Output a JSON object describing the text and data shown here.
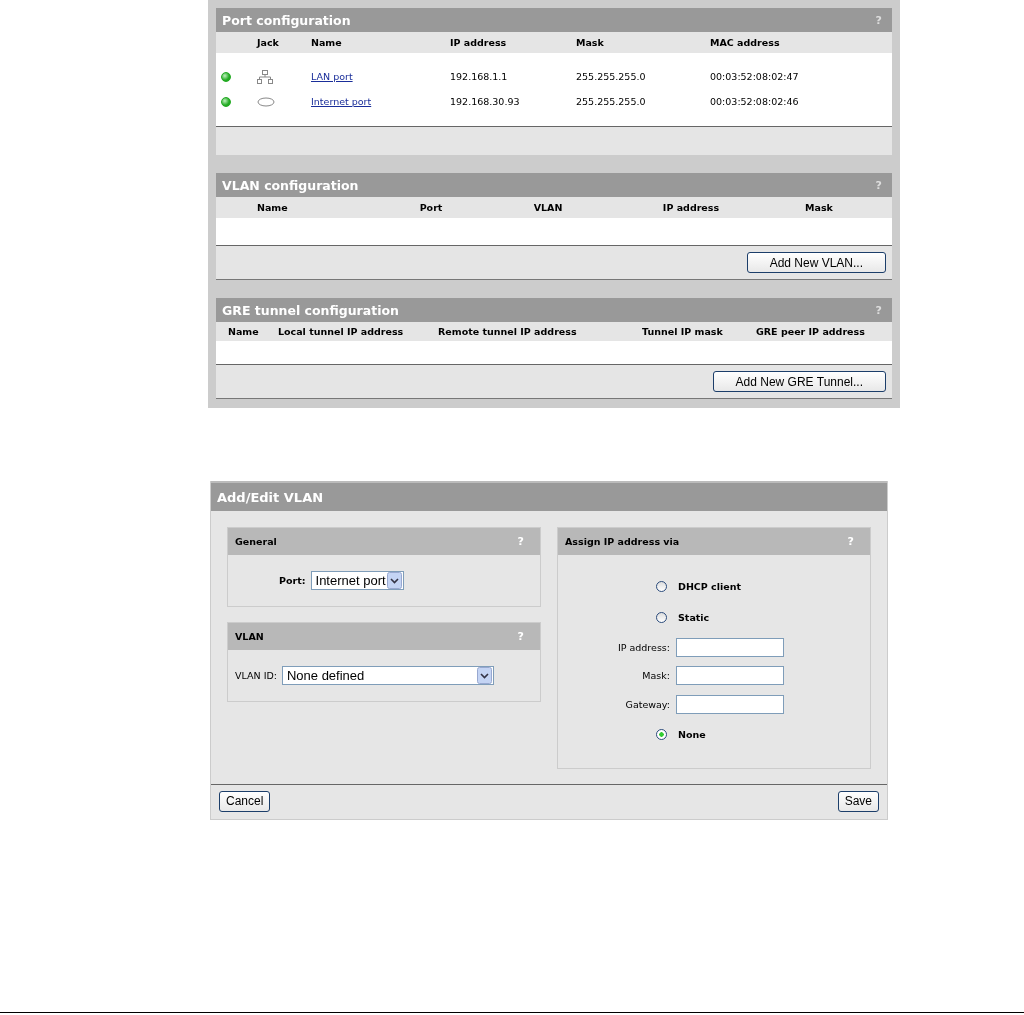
{
  "port_configuration": {
    "title": "Port configuration",
    "help": "?",
    "columns": [
      "Jack",
      "Name",
      "IP address",
      "Mask",
      "MAC address"
    ],
    "rows": [
      {
        "color": "#22aa22",
        "kind": "lan",
        "name": "LAN port",
        "ip": "192.168.1.1",
        "mask": "255.255.255.0",
        "mac": "00:03:52:08:02:47"
      },
      {
        "color": "#22aa22",
        "kind": "internet",
        "name": "Internet port",
        "ip": "192.168.30.93",
        "mask": "255.255.255.0",
        "mac": "00:03:52:08:02:46"
      }
    ]
  },
  "vlan_configuration": {
    "title": "VLAN configuration",
    "help": "?",
    "columns": [
      "Name",
      "Port",
      "VLAN",
      "IP address",
      "Mask"
    ],
    "button": "Add New VLAN..."
  },
  "gre_configuration": {
    "title": "GRE tunnel configuration",
    "help": "?",
    "columns": [
      "Name",
      "Local tunnel IP address",
      "Remote tunnel IP address",
      "Tunnel IP mask",
      "GRE peer IP address"
    ],
    "button": "Add New GRE Tunnel..."
  },
  "add_edit_vlan": {
    "title": "Add/Edit VLAN",
    "general": {
      "title": "General",
      "help": "?",
      "port_label": "Port:",
      "port_value": "Internet port"
    },
    "vlan": {
      "title": "VLAN",
      "help": "?",
      "id_label": "VLAN ID:",
      "id_value": "None defined"
    },
    "assign": {
      "title": "Assign IP address via",
      "help": "?",
      "options": [
        {
          "kind": "radio",
          "label": "DHCP client",
          "selected": false
        },
        {
          "kind": "radio",
          "label": "Static",
          "selected": false
        },
        {
          "kind": "field",
          "label": "IP address:"
        },
        {
          "kind": "field",
          "label": "Mask:"
        },
        {
          "kind": "field",
          "label": "Gateway:"
        },
        {
          "kind": "radio",
          "label": "None",
          "selected": true
        }
      ]
    },
    "cancel": "Cancel",
    "save": "Save"
  }
}
